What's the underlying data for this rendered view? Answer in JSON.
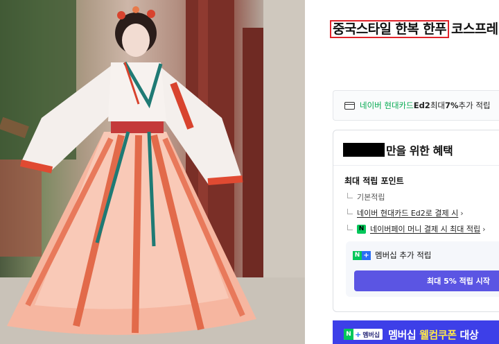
{
  "product": {
    "title_highlight": "중국스타일 한복 한푸",
    "title_rest": "코스프레"
  },
  "card_benefit": {
    "icon": "credit-card-icon",
    "prefix": "네이버 현대카드 ",
    "card_name": "Ed2",
    "mid": " 최대 ",
    "rate": "7%",
    "suffix": " 추가 적립"
  },
  "benefits": {
    "heading_suffix": "만을 위한 혜택",
    "max_point_label": "최대 적립 포인트",
    "basic_label": "기본적립",
    "card_link": "네이버 현대카드 Ed2로 결제 시",
    "npay_link": "네이버페이 머니 결제 시 최대 적립",
    "chevron": "›",
    "npay_badge": "N",
    "membership_line": "멤버십 추가 적립",
    "membership_badge_n": "N",
    "membership_badge_plus": "+",
    "start_button": "최대 5% 적립 시작"
  },
  "coupon_banner": {
    "badge_n": "N",
    "badge_plus": "+",
    "badge_text": "멤버십",
    "text_white": "멤버십 ",
    "text_yellow": "웰컴쿠폰",
    "text_end": " 대상"
  },
  "colors": {
    "highlight_border": "#e0222a",
    "naver_green": "#03c75a",
    "point_green": "#03a94f",
    "button_purple": "#5b55e3",
    "banner_blue": "#3d3fe8"
  }
}
